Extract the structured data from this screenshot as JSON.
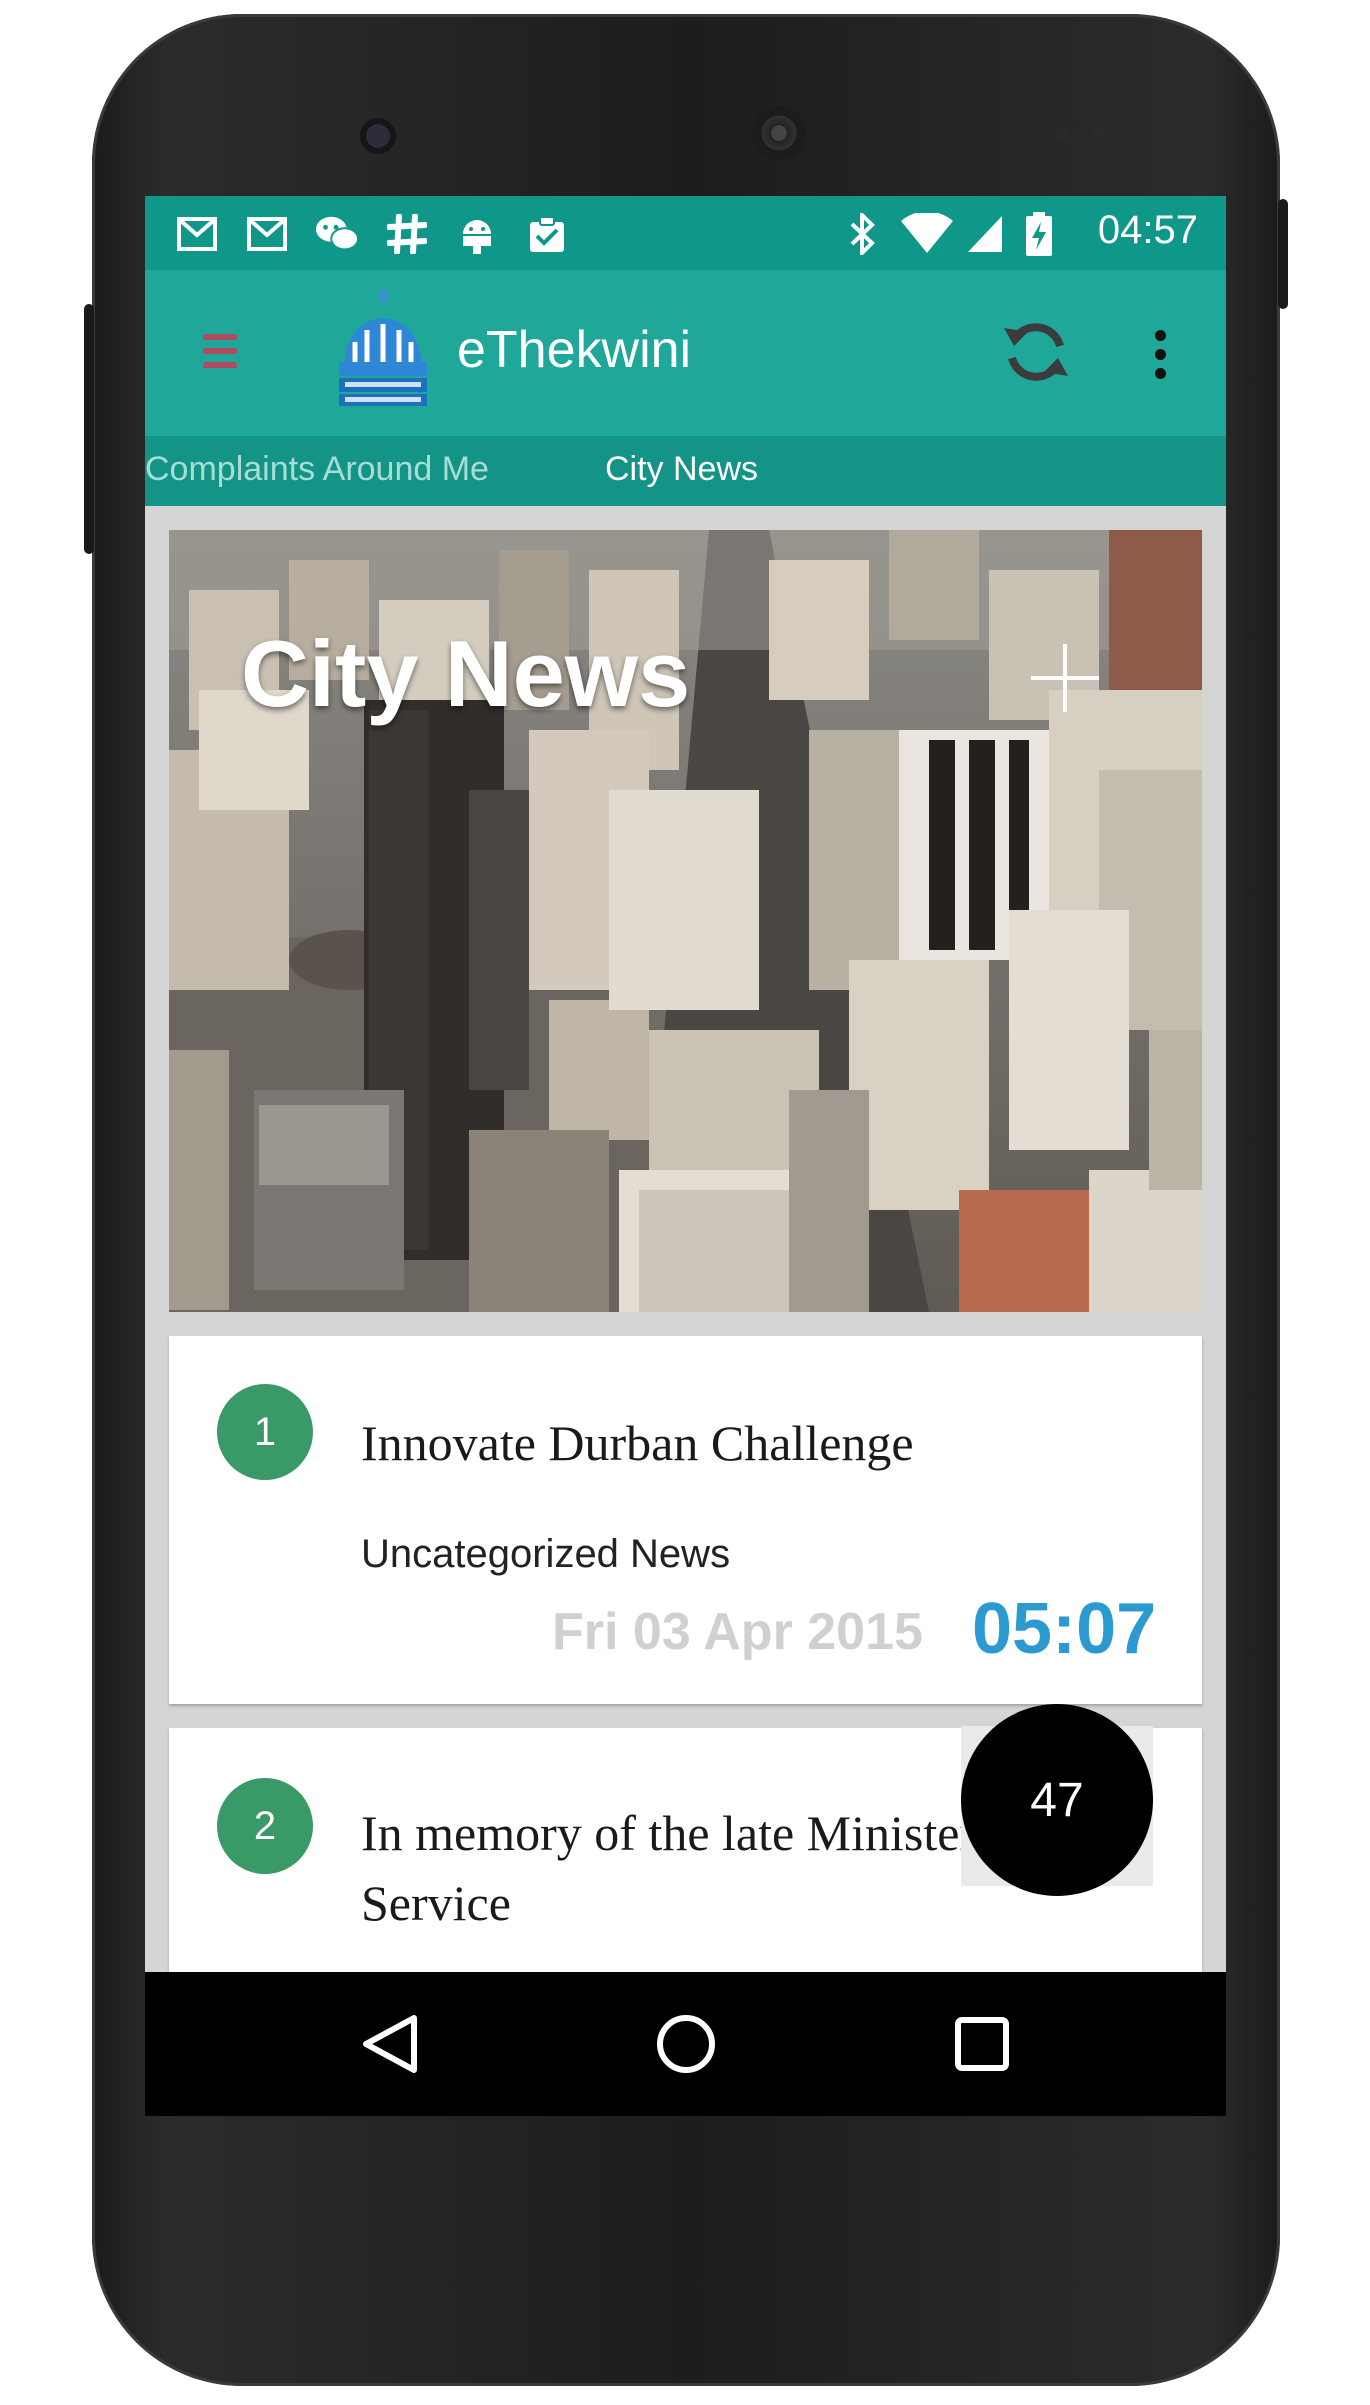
{
  "statusbar": {
    "icons": [
      "gmail-icon",
      "gmail-icon",
      "wechat-icon",
      "slack-icon",
      "android-icon",
      "clipboard-check-icon",
      "bluetooth-icon",
      "wifi-icon",
      "signal-icon",
      "battery-charging-icon"
    ],
    "time": "04:57"
  },
  "toolbar": {
    "menu_icon": "hamburger-icon",
    "logo_icon": "ethekwini-municipality-logo",
    "title": "eThekwini",
    "refresh_icon": "refresh-icon",
    "overflow_icon": "more-vert-icon"
  },
  "tabs": [
    {
      "label": "Complaints Around Me",
      "selected": false
    },
    {
      "label": "City News",
      "selected": true
    }
  ],
  "hero": {
    "title": "City News",
    "add_icon": "plus-icon"
  },
  "news": [
    {
      "number": "1",
      "title": "Innovate Durban Challenge",
      "category": "Uncategorized News",
      "date": "Fri 03 Apr 2015",
      "time": "05:07"
    },
    {
      "number": "2",
      "title": "In memory of the late Minister Public Service"
    }
  ],
  "fab": {
    "count": "47"
  },
  "navbar": {
    "back_icon": "back-icon",
    "home_icon": "home-icon",
    "recents_icon": "recents-icon"
  },
  "colors": {
    "statusbar": "#0f9789",
    "toolbar": "#1fa89a",
    "tabs": "#139486",
    "badge": "#3a9a67",
    "time_accent": "#2a9ad0"
  }
}
